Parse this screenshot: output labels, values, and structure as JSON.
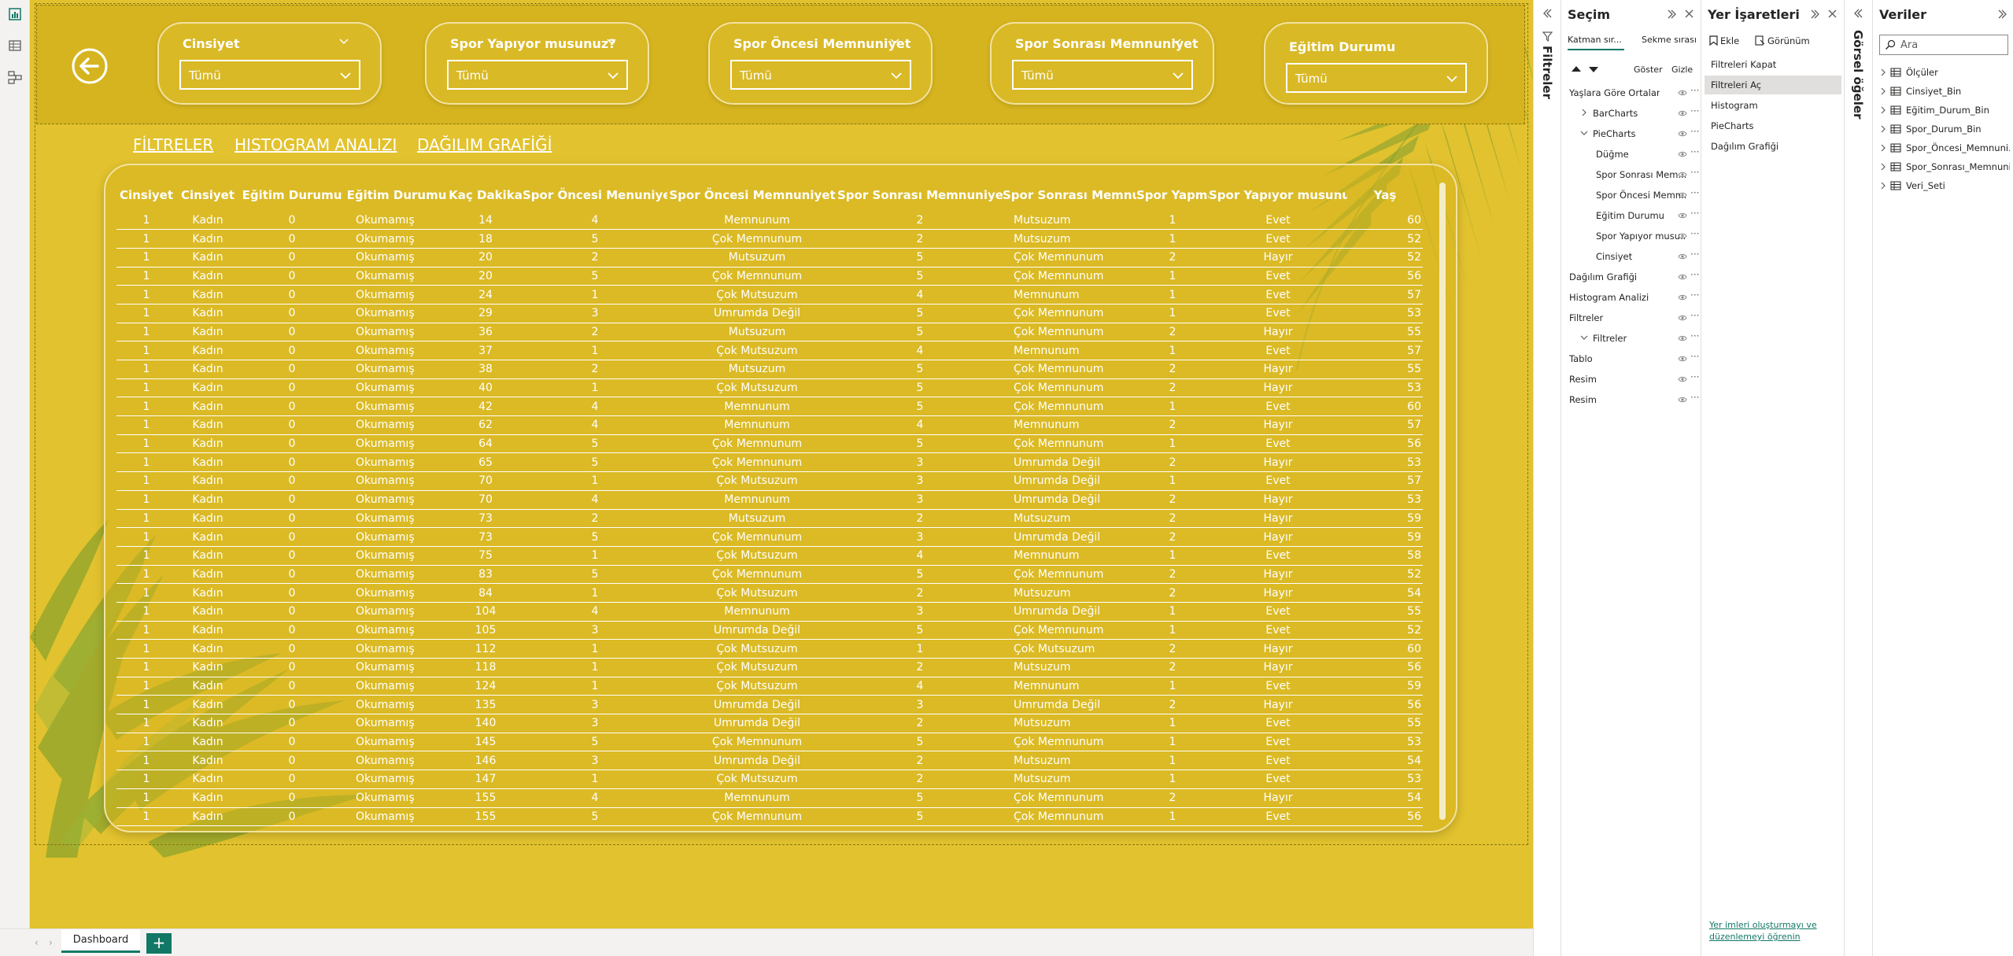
{
  "slicers": [
    {
      "title": "Cinsiyet",
      "value": "Tümü"
    },
    {
      "title": "Spor Yapıyor musunuz?",
      "value": "Tümü"
    },
    {
      "title": "Spor Öncesi Memnuniyet",
      "value": "Tümü"
    },
    {
      "title": "Spor Sonrası Memnuniyet",
      "value": "Tümü"
    },
    {
      "title": "Eğitim Durumu",
      "value": "Tümü"
    }
  ],
  "nav": {
    "filters": "FİLTRELER",
    "histogram": "HISTOGRAM ANALIZI",
    "scatter": "DAĞILIM GRAFİĞİ"
  },
  "table": {
    "columns": [
      "Cinsiyet",
      "Cinsiyet",
      "Eğitim Durumu",
      "Eğitim Durumu",
      "Kaç Dakika",
      "Spor Öncesi Menuniyet",
      "Spor Öncesi Memnuniyet",
      "Spor Sonrası Memnuniyet",
      "Spor Sonrası Memnuniyet",
      "Spor Yapmak",
      "Spor Yapıyor musunuz?",
      "Yaş"
    ],
    "rows": [
      [
        "1",
        "Kadın",
        "0",
        "Okumamış",
        "14",
        "4",
        "Memnunum",
        "2",
        "Mutsuzum",
        "1",
        "Evet",
        "60"
      ],
      [
        "1",
        "Kadın",
        "0",
        "Okumamış",
        "18",
        "5",
        "Çok Memnunum",
        "2",
        "Mutsuzum",
        "1",
        "Evet",
        "52"
      ],
      [
        "1",
        "Kadın",
        "0",
        "Okumamış",
        "20",
        "2",
        "Mutsuzum",
        "5",
        "Çok Memnunum",
        "2",
        "Hayır",
        "52"
      ],
      [
        "1",
        "Kadın",
        "0",
        "Okumamış",
        "20",
        "5",
        "Çok Memnunum",
        "5",
        "Çok Memnunum",
        "1",
        "Evet",
        "56"
      ],
      [
        "1",
        "Kadın",
        "0",
        "Okumamış",
        "24",
        "1",
        "Çok Mutsuzum",
        "4",
        "Memnunum",
        "1",
        "Evet",
        "57"
      ],
      [
        "1",
        "Kadın",
        "0",
        "Okumamış",
        "29",
        "3",
        "Umrumda Değil",
        "5",
        "Çok Memnunum",
        "1",
        "Evet",
        "53"
      ],
      [
        "1",
        "Kadın",
        "0",
        "Okumamış",
        "36",
        "2",
        "Mutsuzum",
        "5",
        "Çok Memnunum",
        "2",
        "Hayır",
        "55"
      ],
      [
        "1",
        "Kadın",
        "0",
        "Okumamış",
        "37",
        "1",
        "Çok Mutsuzum",
        "4",
        "Memnunum",
        "1",
        "Evet",
        "57"
      ],
      [
        "1",
        "Kadın",
        "0",
        "Okumamış",
        "38",
        "2",
        "Mutsuzum",
        "5",
        "Çok Memnunum",
        "2",
        "Hayır",
        "55"
      ],
      [
        "1",
        "Kadın",
        "0",
        "Okumamış",
        "40",
        "1",
        "Çok Mutsuzum",
        "5",
        "Çok Memnunum",
        "2",
        "Hayır",
        "53"
      ],
      [
        "1",
        "Kadın",
        "0",
        "Okumamış",
        "42",
        "4",
        "Memnunum",
        "5",
        "Çok Memnunum",
        "1",
        "Evet",
        "60"
      ],
      [
        "1",
        "Kadın",
        "0",
        "Okumamış",
        "62",
        "4",
        "Memnunum",
        "4",
        "Memnunum",
        "2",
        "Hayır",
        "57"
      ],
      [
        "1",
        "Kadın",
        "0",
        "Okumamış",
        "64",
        "5",
        "Çok Memnunum",
        "5",
        "Çok Memnunum",
        "1",
        "Evet",
        "56"
      ],
      [
        "1",
        "Kadın",
        "0",
        "Okumamış",
        "65",
        "5",
        "Çok Memnunum",
        "3",
        "Umrumda Değil",
        "2",
        "Hayır",
        "53"
      ],
      [
        "1",
        "Kadın",
        "0",
        "Okumamış",
        "70",
        "1",
        "Çok Mutsuzum",
        "3",
        "Umrumda Değil",
        "1",
        "Evet",
        "57"
      ],
      [
        "1",
        "Kadın",
        "0",
        "Okumamış",
        "70",
        "4",
        "Memnunum",
        "3",
        "Umrumda Değil",
        "2",
        "Hayır",
        "53"
      ],
      [
        "1",
        "Kadın",
        "0",
        "Okumamış",
        "73",
        "2",
        "Mutsuzum",
        "2",
        "Mutsuzum",
        "2",
        "Hayır",
        "59"
      ],
      [
        "1",
        "Kadın",
        "0",
        "Okumamış",
        "73",
        "5",
        "Çok Memnunum",
        "3",
        "Umrumda Değil",
        "2",
        "Hayır",
        "59"
      ],
      [
        "1",
        "Kadın",
        "0",
        "Okumamış",
        "75",
        "1",
        "Çok Mutsuzum",
        "4",
        "Memnunum",
        "1",
        "Evet",
        "58"
      ],
      [
        "1",
        "Kadın",
        "0",
        "Okumamış",
        "83",
        "5",
        "Çok Memnunum",
        "5",
        "Çok Memnunum",
        "2",
        "Hayır",
        "52"
      ],
      [
        "1",
        "Kadın",
        "0",
        "Okumamış",
        "84",
        "1",
        "Çok Mutsuzum",
        "2",
        "Mutsuzum",
        "2",
        "Hayır",
        "54"
      ],
      [
        "1",
        "Kadın",
        "0",
        "Okumamış",
        "104",
        "4",
        "Memnunum",
        "3",
        "Umrumda Değil",
        "1",
        "Evet",
        "55"
      ],
      [
        "1",
        "Kadın",
        "0",
        "Okumamış",
        "105",
        "3",
        "Umrumda Değil",
        "5",
        "Çok Memnunum",
        "1",
        "Evet",
        "52"
      ],
      [
        "1",
        "Kadın",
        "0",
        "Okumamış",
        "112",
        "1",
        "Çok Mutsuzum",
        "1",
        "Çok Mutsuzum",
        "2",
        "Hayır",
        "60"
      ],
      [
        "1",
        "Kadın",
        "0",
        "Okumamış",
        "118",
        "1",
        "Çok Mutsuzum",
        "2",
        "Mutsuzum",
        "2",
        "Hayır",
        "56"
      ],
      [
        "1",
        "Kadın",
        "0",
        "Okumamış",
        "124",
        "1",
        "Çok Mutsuzum",
        "4",
        "Memnunum",
        "1",
        "Evet",
        "59"
      ],
      [
        "1",
        "Kadın",
        "0",
        "Okumamış",
        "135",
        "3",
        "Umrumda Değil",
        "3",
        "Umrumda Değil",
        "2",
        "Hayır",
        "56"
      ],
      [
        "1",
        "Kadın",
        "0",
        "Okumamış",
        "140",
        "3",
        "Umrumda Değil",
        "2",
        "Mutsuzum",
        "1",
        "Evet",
        "55"
      ],
      [
        "1",
        "Kadın",
        "0",
        "Okumamış",
        "145",
        "5",
        "Çok Memnunum",
        "5",
        "Çok Memnunum",
        "1",
        "Evet",
        "53"
      ],
      [
        "1",
        "Kadın",
        "0",
        "Okumamış",
        "146",
        "3",
        "Umrumda Değil",
        "2",
        "Mutsuzum",
        "1",
        "Evet",
        "54"
      ],
      [
        "1",
        "Kadın",
        "0",
        "Okumamış",
        "147",
        "1",
        "Çok Mutsuzum",
        "2",
        "Mutsuzum",
        "1",
        "Evet",
        "53"
      ],
      [
        "1",
        "Kadın",
        "0",
        "Okumamış",
        "155",
        "4",
        "Memnunum",
        "5",
        "Çok Memnunum",
        "2",
        "Hayır",
        "54"
      ],
      [
        "1",
        "Kadın",
        "0",
        "Okumamış",
        "155",
        "5",
        "Çok Memnunum",
        "5",
        "Çok Memnunum",
        "1",
        "Evet",
        "56"
      ]
    ]
  },
  "tabs": {
    "active": "Dashboard",
    "add": "+"
  },
  "filters_pane": {
    "label": "Filtreler"
  },
  "selection": {
    "title": "Seçim",
    "tab_layer": "Katman sır...",
    "tab_order": "Sekme sırası",
    "show": "Göster",
    "hide": "Gizle",
    "items": [
      {
        "label": "Yaşlara Göre Ortalama ...",
        "indent": 0,
        "caret": ""
      },
      {
        "label": "BarCharts",
        "indent": 1,
        "caret": "right"
      },
      {
        "label": "PieCharts",
        "indent": 1,
        "caret": "down"
      },
      {
        "label": "Düğme",
        "indent": 2,
        "caret": ""
      },
      {
        "label": "Spor Sonrası Mem...",
        "indent": 2,
        "caret": ""
      },
      {
        "label": "Spor Öncesi Memn...",
        "indent": 2,
        "caret": ""
      },
      {
        "label": "Eğitim Durumu",
        "indent": 2,
        "caret": ""
      },
      {
        "label": "Spor Yapıyor musu...",
        "indent": 2,
        "caret": ""
      },
      {
        "label": "Cinsiyet",
        "indent": 2,
        "caret": ""
      },
      {
        "label": "Dağılım Grafiği",
        "indent": 0,
        "caret": ""
      },
      {
        "label": "Histogram Analizi",
        "indent": 0,
        "caret": ""
      },
      {
        "label": "Filtreler",
        "indent": 0,
        "caret": ""
      },
      {
        "label": "Filtreler",
        "indent": 1,
        "caret": "down"
      },
      {
        "label": "Tablo",
        "indent": 0,
        "caret": ""
      },
      {
        "label": "Resim",
        "indent": 0,
        "caret": ""
      },
      {
        "label": "Resim",
        "indent": 0,
        "caret": ""
      }
    ]
  },
  "bookmarks": {
    "title": "Yer İşaretleri",
    "add": "Ekle",
    "view": "Görünüm",
    "items": [
      {
        "label": "Filtreleri Kapat",
        "active": false
      },
      {
        "label": "Filtreleri Aç",
        "active": true
      },
      {
        "label": "Histogram",
        "active": false
      },
      {
        "label": "PieCharts",
        "active": false
      },
      {
        "label": "Dağılım Grafiği",
        "active": false
      }
    ],
    "learn_link": "Yer imleri oluşturmayı ve düzenlemeyi öğrenin"
  },
  "visuals_pane": {
    "label": "Görsel öğeler"
  },
  "data_pane": {
    "title": "Veriler",
    "search_placeholder": "Ara",
    "items": [
      {
        "label": "Ölçüler",
        "icon": "measure-table-icon"
      },
      {
        "label": "Cinsiyet_Bin",
        "icon": "table-icon"
      },
      {
        "label": "Eğitim_Durum_Bin",
        "icon": "table-icon"
      },
      {
        "label": "Spor_Durum_Bin",
        "icon": "table-icon"
      },
      {
        "label": "Spor_Öncesi_Memnuni...",
        "icon": "table-icon"
      },
      {
        "label": "Spor_Sonrası_Memnuni...",
        "icon": "table-icon"
      },
      {
        "label": "Veri_Seti",
        "icon": "table-icon"
      }
    ]
  },
  "colors": {
    "report_bg": "#e2c22e",
    "accent": "#117865",
    "white": "#ffffff"
  }
}
